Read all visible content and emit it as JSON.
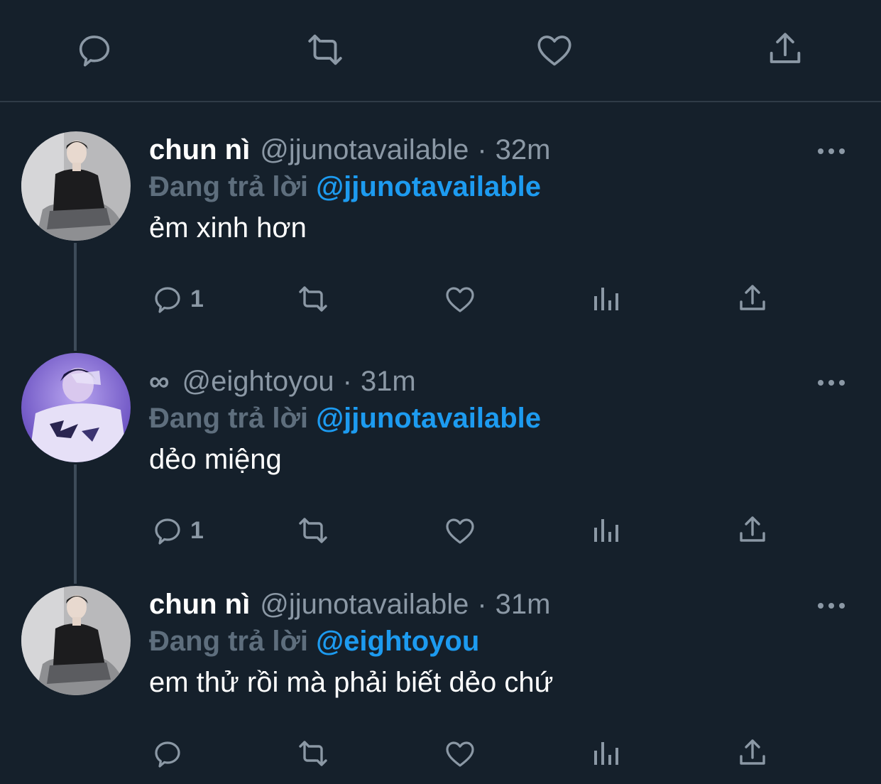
{
  "top_actions": {
    "reply_icon": "comment-icon",
    "retweet_icon": "retweet-icon",
    "like_icon": "heart-icon",
    "share_icon": "share-icon"
  },
  "colors": {
    "background": "#15202b",
    "muted": "#8b98a5",
    "accent": "#1d9bf0",
    "divider": "#2f3b47"
  },
  "tweets": [
    {
      "name": "chun nì",
      "handle": "@jjunotavailable",
      "separator": "·",
      "time": "32m",
      "reply_prefix": "Đang trả lời",
      "reply_to": "@jjunotavailable",
      "text": "ẻm xinh hơn",
      "reply_count": "1"
    },
    {
      "name": "∞",
      "handle": "@eightoyou",
      "separator": "·",
      "time": "31m",
      "reply_prefix": "Đang trả lời",
      "reply_to": "@jjunotavailable",
      "text": "dẻo miệng",
      "reply_count": "1"
    },
    {
      "name": "chun nì",
      "handle": "@jjunotavailable",
      "separator": "·",
      "time": "31m",
      "reply_prefix": "Đang trả lời",
      "reply_to": "@eightoyou",
      "text": "em thử rồi mà phải biết dẻo chứ",
      "reply_count": ""
    }
  ]
}
